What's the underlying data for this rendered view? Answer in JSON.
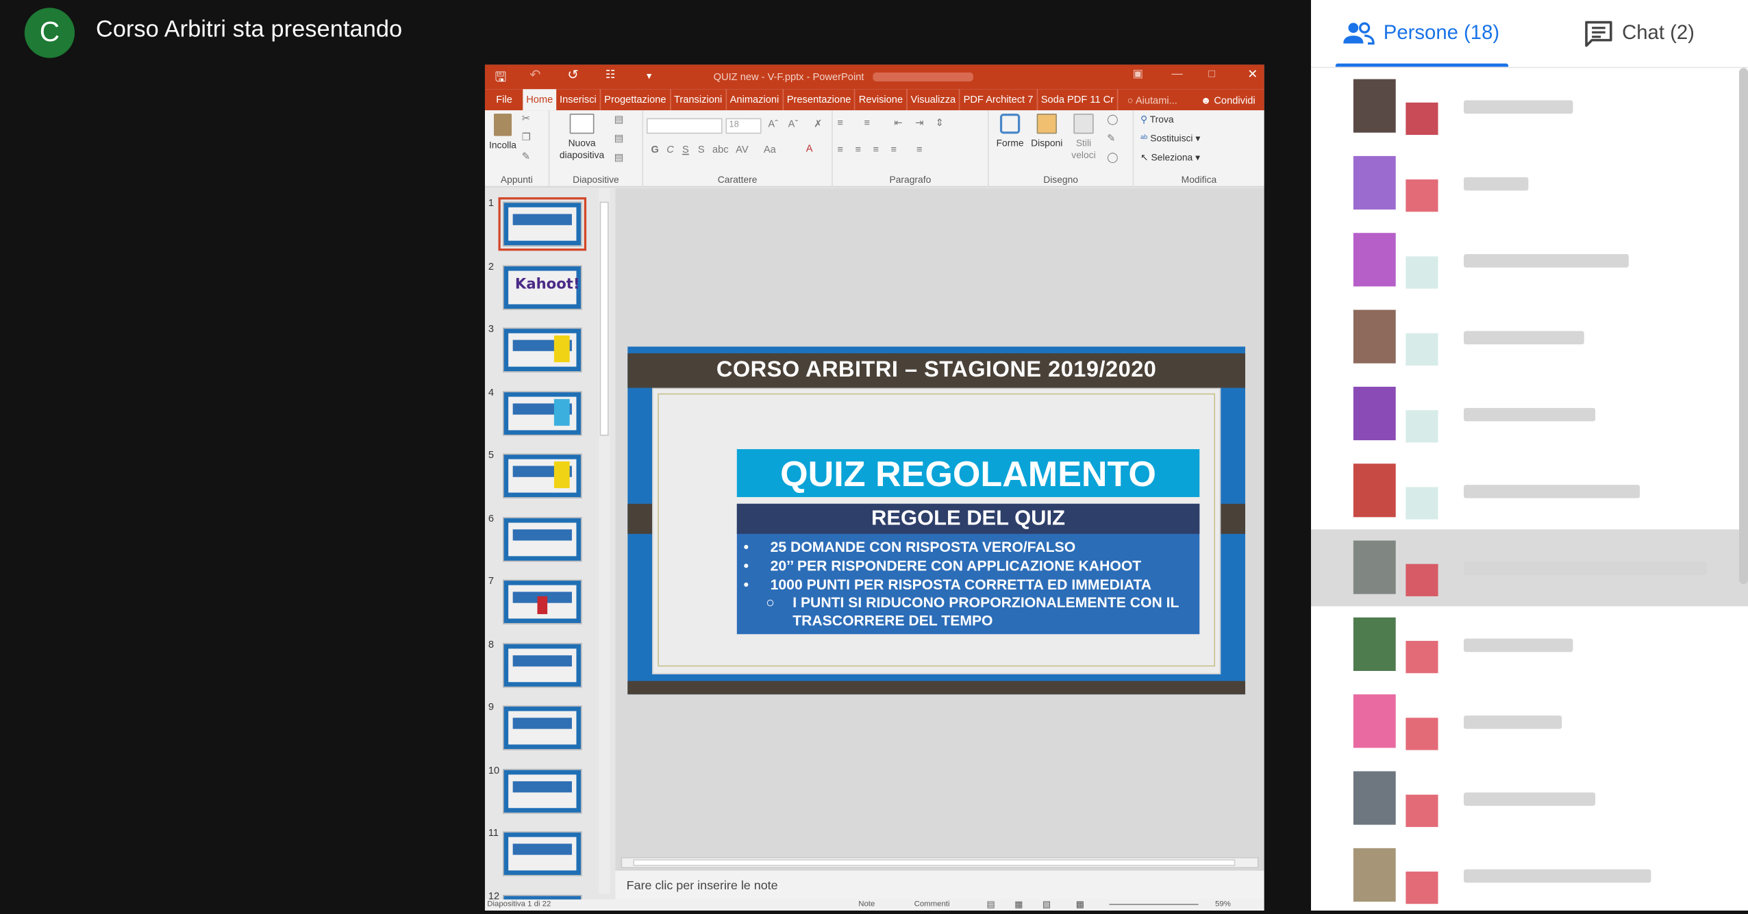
{
  "meet": {
    "presenter_initial": "C",
    "presenter_title": "Corso Arbitri sta presentando",
    "tabs": {
      "people": "Persone (18)",
      "chat": "Chat (2)"
    },
    "participants": [
      {
        "colors": [
          "#5a4a45",
          "#c84b57"
        ],
        "highlight": false
      },
      {
        "colors": [
          "#9c6bd0",
          "#e36b78"
        ],
        "highlight": false
      },
      {
        "colors": [
          "#b65fc9",
          "#d7ece9"
        ],
        "highlight": false
      },
      {
        "colors": [
          "#8d6a5c",
          "#d7ece9"
        ],
        "highlight": false
      },
      {
        "colors": [
          "#8b4bb6",
          "#d7ece9"
        ],
        "highlight": false
      },
      {
        "colors": [
          "#c84a45",
          "#d7ece9"
        ],
        "highlight": false
      },
      {
        "colors": [
          "#808782",
          "#d75b66"
        ],
        "highlight": true
      },
      {
        "colors": [
          "#4f7c4e",
          "#e36b78"
        ],
        "highlight": false
      },
      {
        "colors": [
          "#e86aa0",
          "#e36b78"
        ],
        "highlight": false
      },
      {
        "colors": [
          "#6e7780",
          "#e36b78"
        ],
        "highlight": false
      },
      {
        "colors": [
          "#a69677",
          "#e36b78"
        ],
        "highlight": false
      }
    ]
  },
  "ppt": {
    "window_title": "QUIZ new - V-F.pptx - PowerPoint",
    "tabs": [
      "File",
      "Home",
      "Inserisci",
      "Progettazione",
      "Transizioni",
      "Animazioni",
      "Presentazione",
      "Revisione",
      "Visualizza",
      "PDF Architect 7",
      "Soda PDF 11 Cr"
    ],
    "help": "Aiutami...",
    "share": "Condividi",
    "ribbon": {
      "paste": "Incolla",
      "new_slide_1": "Nuova",
      "new_slide_2": "diapositiva",
      "font_size": "18",
      "shapes": "Forme",
      "arrange": "Disponi",
      "quick_styles_1": "Stili",
      "quick_styles_2": "veloci",
      "find": "Trova",
      "replace": "Sostituisci",
      "select": "Seleziona",
      "font_buttons": [
        "G",
        "C",
        "S",
        "S",
        "abc",
        "AV",
        "Aa"
      ],
      "groups": {
        "clipboard": "Appunti",
        "slides": "Diapositive",
        "font": "Carattere",
        "paragraph": "Paragrafo",
        "drawing": "Disegno",
        "editing": "Modifica"
      }
    },
    "thumbnails": [
      "1",
      "2",
      "3",
      "4",
      "5",
      "6",
      "7",
      "8",
      "9",
      "10",
      "11",
      "12"
    ],
    "thumb_kahoot": "Kahoot!",
    "slide": {
      "header": "CORSO ARBITRI – STAGIONE 2019/2020",
      "title": "QUIZ REGOLAMENTO",
      "rules_title": "REGOLE DEL QUIZ",
      "bullets": [
        "25 DOMANDE CON RISPOSTA VERO/FALSO",
        "20’’ PER RISPONDERE CON APPLICAZIONE KAHOOT",
        "1000 PUNTI PER RISPOSTA CORRETTA ED IMMEDIATA"
      ],
      "sub_bullet": "I PUNTI SI RIDUCONO PROPORZIONALEMENTE CON IL TRASCORRERE DEL TEMPO"
    },
    "notes_placeholder": "Fare clic per inserire le note",
    "status": {
      "slide_counter": "Diapositiva 1 di 22",
      "notes": "Note",
      "comments": "Commenti",
      "zoom": "59%"
    }
  }
}
